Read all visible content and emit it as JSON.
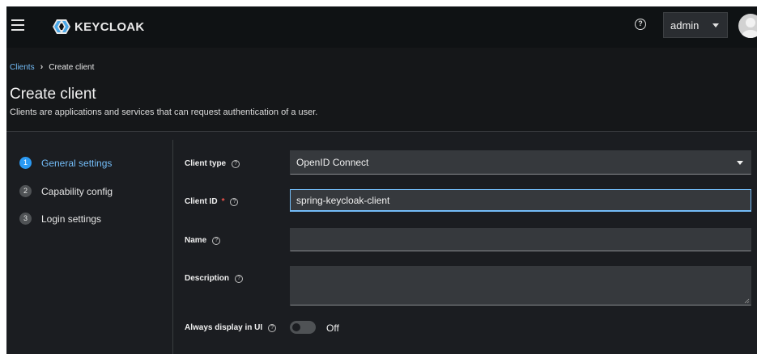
{
  "masthead": {
    "brand": "KEYCLOAK",
    "help_icon": "help-circle-icon",
    "user_name": "admin",
    "avatar_icon": "user-avatar-icon"
  },
  "breadcrumb": {
    "parent": "Clients",
    "separator": "›",
    "current": "Create client"
  },
  "header": {
    "title": "Create client",
    "description": "Clients are applications and services that can request authentication of a user."
  },
  "wizard": {
    "steps": [
      {
        "number": "1",
        "label": "General settings",
        "active": true
      },
      {
        "number": "2",
        "label": "Capability config",
        "active": false
      },
      {
        "number": "3",
        "label": "Login settings",
        "active": false
      }
    ]
  },
  "form": {
    "client_type": {
      "label": "Client type",
      "value": "OpenID Connect"
    },
    "client_id": {
      "label": "Client ID",
      "required_mark": "*",
      "value": "spring-keycloak-client"
    },
    "name": {
      "label": "Name",
      "value": ""
    },
    "description": {
      "label": "Description",
      "value": ""
    },
    "always_display": {
      "label": "Always display in UI",
      "state": "Off"
    },
    "help_glyph": "?"
  },
  "colors": {
    "accent": "#73bcf7",
    "active_step": "#2b9af3",
    "background": "#1b1d21",
    "masthead": "#0f1214",
    "required": "#f0544c"
  }
}
